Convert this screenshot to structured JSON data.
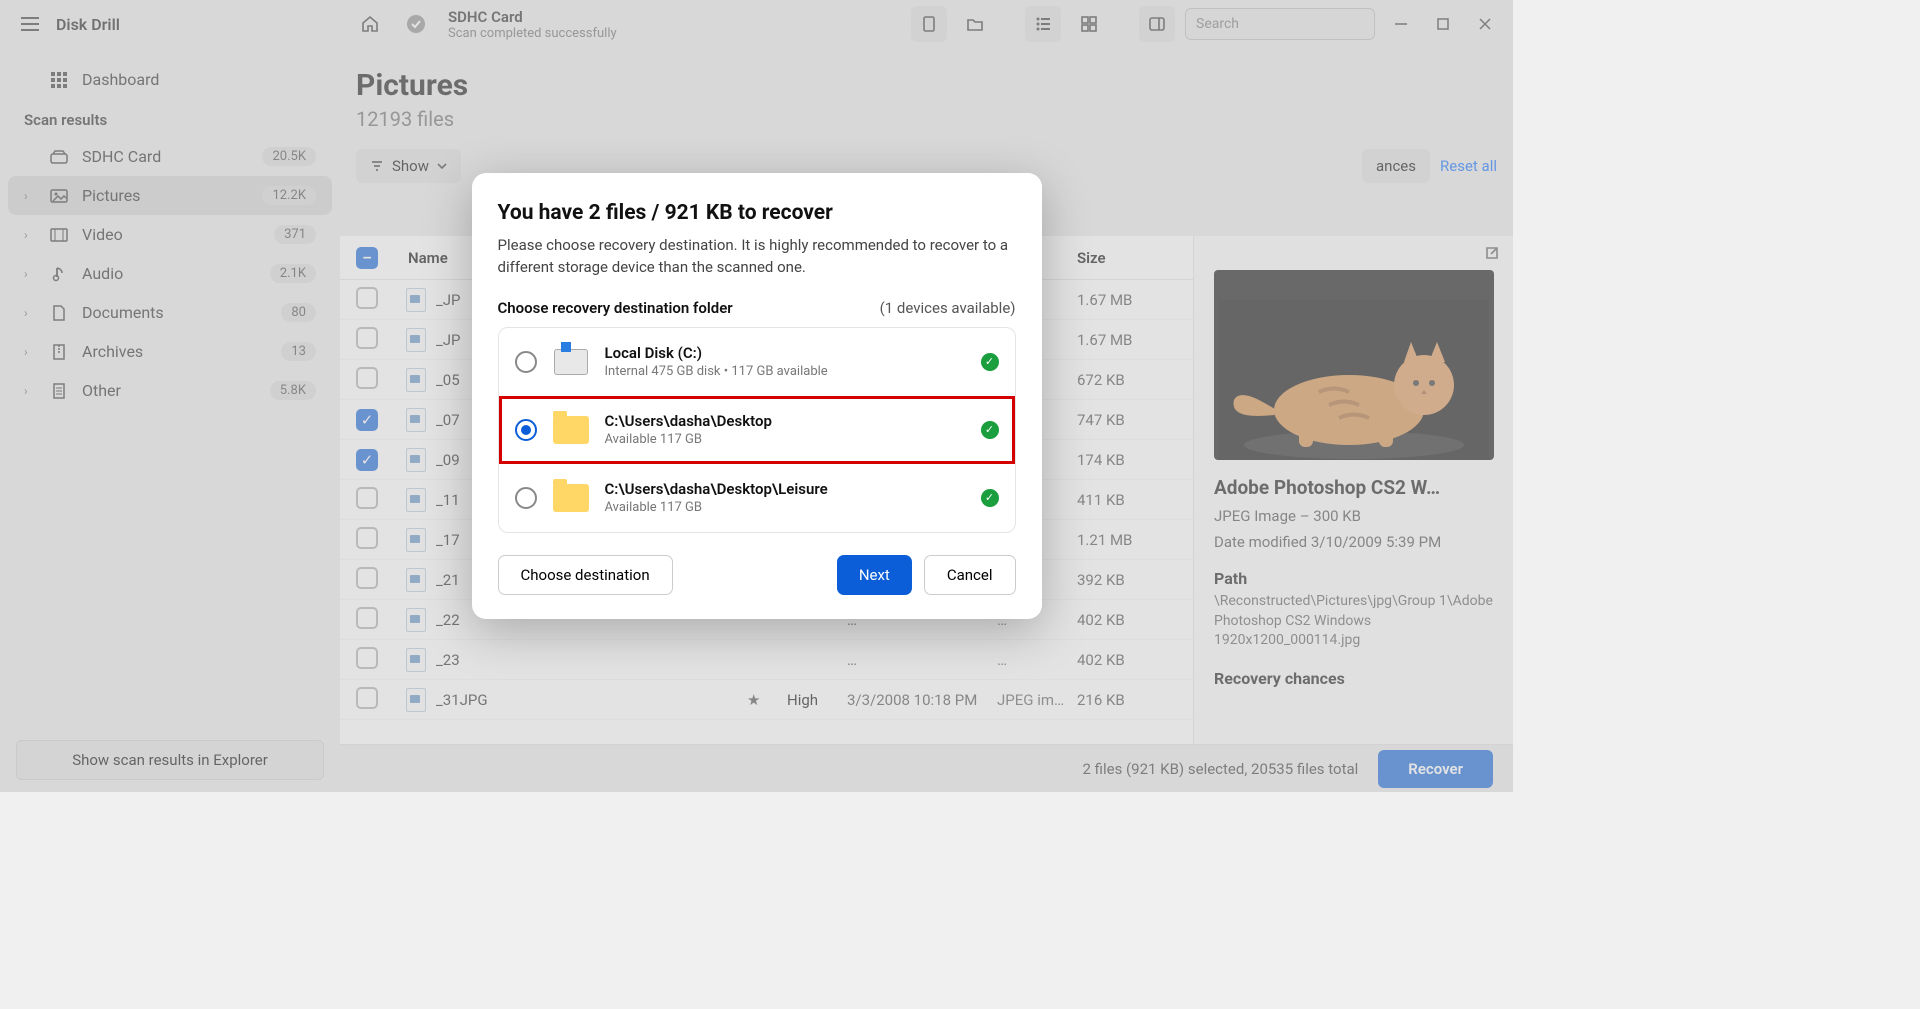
{
  "app": {
    "title": "Disk Drill"
  },
  "sidebar": {
    "dashboard": "Dashboard",
    "section": "Scan results",
    "device": {
      "label": "SDHC Card",
      "count": "20.5K"
    },
    "items": [
      {
        "label": "Pictures",
        "count": "12.2K"
      },
      {
        "label": "Video",
        "count": "371"
      },
      {
        "label": "Audio",
        "count": "2.1K"
      },
      {
        "label": "Documents",
        "count": "80"
      },
      {
        "label": "Archives",
        "count": "13"
      },
      {
        "label": "Other",
        "count": "5.8K"
      }
    ],
    "footer_btn": "Show scan results in Explorer"
  },
  "header": {
    "title": "SDHC Card",
    "subtitle": "Scan completed successfully",
    "search_placeholder": "Search"
  },
  "page": {
    "title": "Pictures",
    "subtitle": "12193 files",
    "show": "Show",
    "chances": "ances",
    "reset": "Reset all"
  },
  "table": {
    "cols": {
      "name": "Name",
      "size": "Size"
    },
    "rows": [
      {
        "checked": false,
        "name": "_JP",
        "date": "…",
        "type": "…",
        "size": "1.67 MB"
      },
      {
        "checked": false,
        "name": "_JP",
        "date": "…",
        "type": "…",
        "size": "1.67 MB"
      },
      {
        "checked": false,
        "name": "_05",
        "date": "…",
        "type": "…",
        "size": "672 KB"
      },
      {
        "checked": true,
        "name": "_07",
        "date": "…",
        "type": "…",
        "size": "747 KB"
      },
      {
        "checked": true,
        "name": "_09",
        "date": "…",
        "type": "…",
        "size": "174 KB"
      },
      {
        "checked": false,
        "name": "_11",
        "date": "…",
        "type": "…",
        "size": "411 KB"
      },
      {
        "checked": false,
        "name": "_17",
        "date": "…",
        "type": "…",
        "size": "1.21 MB"
      },
      {
        "checked": false,
        "name": "_21",
        "date": "…",
        "type": "…",
        "size": "392 KB"
      },
      {
        "checked": false,
        "name": "_22",
        "date": "…",
        "type": "…",
        "size": "402 KB"
      },
      {
        "checked": false,
        "name": "_23",
        "date": "…",
        "type": "…",
        "size": "402 KB"
      },
      {
        "checked": false,
        "name": "_31JPG",
        "date": "3/3/2008 10:18 PM",
        "type": "JPEG im…",
        "size": "216 KB",
        "chance": "High"
      }
    ]
  },
  "preview": {
    "title": "Adobe Photoshop CS2 W…",
    "meta": "JPEG Image – 300 KB",
    "modified": "Date modified 3/10/2009 5:39 PM",
    "path_label": "Path",
    "path": "\\Reconstructed\\Pictures\\jpg\\Group 1\\Adobe Photoshop CS2 Windows 1920x1200_000114.jpg",
    "chances_label": "Recovery chances"
  },
  "footer": {
    "summary": "2 files (921 KB) selected, 20535 files total",
    "recover": "Recover"
  },
  "modal": {
    "title": "You have 2 files / 921 KB to recover",
    "desc": "Please choose recovery destination. It is highly recommended to recover to a different storage device than the scanned one.",
    "choose_label": "Choose recovery destination folder",
    "devices_available": "(1 devices available)",
    "destinations": [
      {
        "name": "Local Disk (C:)",
        "sub": "Internal 475 GB disk • 117 GB available",
        "selected": false,
        "type": "drive"
      },
      {
        "name": "C:\\Users\\dasha\\Desktop",
        "sub": "Available 117 GB",
        "selected": true,
        "type": "folder",
        "highlight": true
      },
      {
        "name": "C:\\Users\\dasha\\Desktop\\Leisure",
        "sub": "Available 117 GB",
        "selected": false,
        "type": "folder"
      }
    ],
    "choose_btn": "Choose destination",
    "next_btn": "Next",
    "cancel_btn": "Cancel"
  }
}
